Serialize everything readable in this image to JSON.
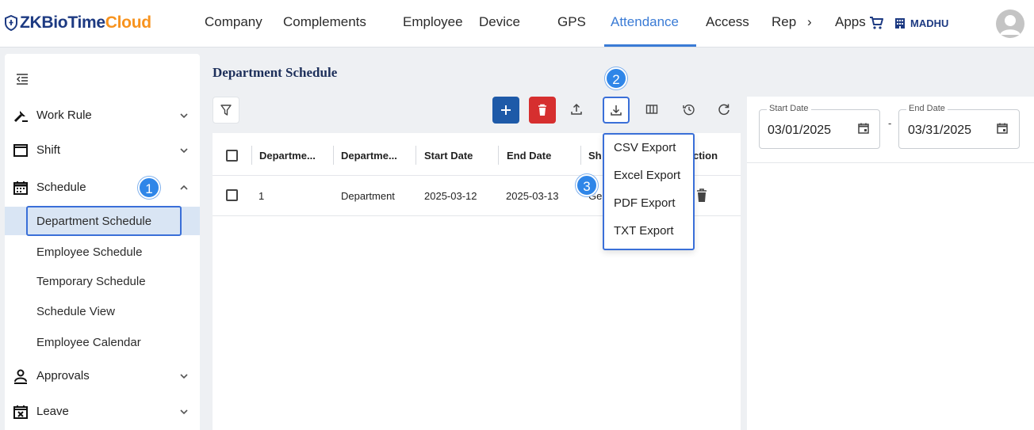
{
  "app": {
    "logo_prefix": "ZKBioTime",
    "logo_suffix": "Cloud"
  },
  "nav": {
    "items": [
      "Company",
      "Complements",
      "Employee",
      "Device",
      "GPS",
      "Attendance",
      "Access",
      "Rep",
      "Apps"
    ],
    "more_glyph": "›",
    "active": "Attendance",
    "user": "MADHU"
  },
  "sidebar": {
    "items": [
      {
        "label": "Work Rule",
        "icon": "work-rule-icon",
        "expanded": false
      },
      {
        "label": "Shift",
        "icon": "shift-icon",
        "expanded": false
      },
      {
        "label": "Schedule",
        "icon": "schedule-icon",
        "expanded": true
      },
      {
        "label": "Approvals",
        "icon": "approvals-icon",
        "expanded": false
      },
      {
        "label": "Leave",
        "icon": "leave-icon",
        "expanded": false
      }
    ],
    "schedule_children": [
      "Department Schedule",
      "Employee Schedule",
      "Temporary Schedule",
      "Schedule View",
      "Employee Calendar"
    ],
    "active_child": "Department Schedule"
  },
  "page": {
    "title": "Department Schedule"
  },
  "table": {
    "columns": [
      "Departme...",
      "Departme...",
      "Start Date",
      "End Date",
      "Sh",
      "ction"
    ],
    "rows": [
      {
        "col1": "1",
        "col2": "Department",
        "start": "2025-03-12",
        "end": "2025-03-13",
        "shift": "Ge"
      }
    ]
  },
  "export_menu": {
    "items": [
      "CSV Export",
      "Excel Export",
      "PDF Export",
      "TXT Export"
    ]
  },
  "date_range": {
    "start_label": "Start Date",
    "start_value": "03/01/2025",
    "end_label": "End Date",
    "end_value": "03/31/2025",
    "separator": "-"
  },
  "callouts": [
    "1",
    "2",
    "3"
  ],
  "colors": {
    "accent": "#3a7bd5",
    "brand_navy": "#1d3a82",
    "brand_orange": "#f7931e",
    "delete": "#d62f2f",
    "add": "#1e5aa8"
  }
}
